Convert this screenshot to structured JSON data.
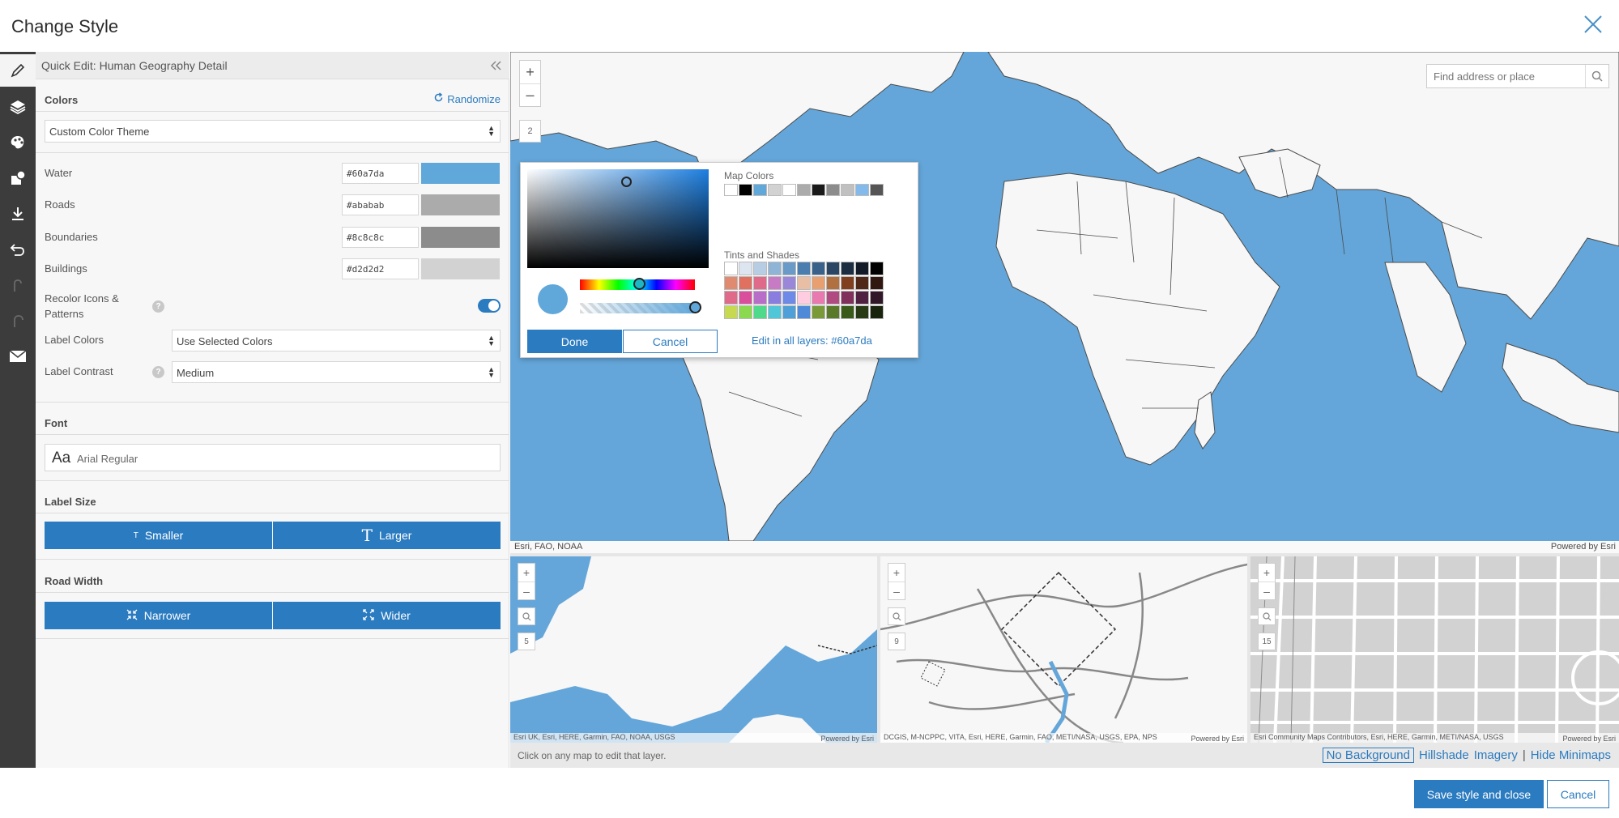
{
  "dialog": {
    "title": "Change Style"
  },
  "panel": {
    "header": "Quick Edit: Human Geography Detail",
    "colors": {
      "title": "Colors",
      "randomize": "Randomize",
      "theme": "Custom Color Theme",
      "rows": [
        {
          "label": "Water",
          "hex": "#60a7da",
          "color": "#60a7da"
        },
        {
          "label": "Roads",
          "hex": "#ababab",
          "color": "#ababab"
        },
        {
          "label": "Boundaries",
          "hex": "#8c8c8c",
          "color": "#8c8c8c"
        },
        {
          "label": "Buildings",
          "hex": "#d2d2d2",
          "color": "#d2d2d2"
        }
      ],
      "recolor_label": "Recolor Icons & Patterns",
      "recolor_on": true,
      "label_colors_label": "Label Colors",
      "label_colors_value": "Use Selected Colors",
      "label_contrast_label": "Label Contrast",
      "label_contrast_value": "Medium"
    },
    "font": {
      "title": "Font",
      "sample": "Aa",
      "name": "Arial Regular"
    },
    "label_size": {
      "title": "Label Size",
      "smaller": "Smaller",
      "larger": "Larger"
    },
    "road_width": {
      "title": "Road Width",
      "narrower": "Narrower",
      "wider": "Wider"
    }
  },
  "map": {
    "zoom_level": "2",
    "search_placeholder": "Find address or place",
    "attribution": "Esri, FAO, NOAA",
    "powered": "Powered by Esri",
    "minimaps": [
      {
        "level": "5",
        "attribution": "Esri UK, Esri, HERE, Garmin, FAO, NOAA, USGS",
        "powered": "Powered by Esri"
      },
      {
        "level": "9",
        "attribution": "DCGIS, M-NCPPC, VITA, Esri, HERE, Garmin, FAO, METI/NASA, USGS, EPA, NPS",
        "powered": "Powered by Esri"
      },
      {
        "level": "15",
        "attribution": "Esri Community Maps Contributors, Esri, HERE, Garmin, METI/NASA, USGS",
        "powered": "Powered by Esri"
      }
    ],
    "hint": "Click on any map to edit that layer.",
    "basemap_links": [
      "No Background",
      "Hillshade",
      "Imagery",
      "Hide Minimaps"
    ]
  },
  "color_picker": {
    "map_colors_title": "Map Colors",
    "map_colors": [
      "#ffffff",
      "#000000",
      "#60a7da",
      "#d2d2d2",
      "#ffffff",
      "#ababab",
      "#1a1a1a",
      "#8c8c8c",
      "#c0c0c0",
      "#84b9ec",
      "#555555"
    ],
    "tints_title": "Tints and Shades",
    "tints": [
      [
        "#ffffff",
        "#dde6f0",
        "#b6cde3",
        "#8fb4d6",
        "#6a9bc8",
        "#4b7eae",
        "#3a6189",
        "#2a4664",
        "#1c2d41",
        "#111a26",
        "#000000"
      ],
      [
        "#e08a6f",
        "#e07060",
        "#e06a8a",
        "#c77bc4",
        "#9a87d9",
        "#e8bfa4",
        "#e8a070",
        "#b07040",
        "#804020",
        "#502818",
        "#301810"
      ],
      [
        "#e06a8a",
        "#d94f9c",
        "#b86ec9",
        "#8a7de0",
        "#6e8ae8",
        "#ffcce0",
        "#e87ab0",
        "#b04a80",
        "#80305a",
        "#502040",
        "#301828"
      ],
      [
        "#c7d94f",
        "#8ad94f",
        "#4fd98a",
        "#4fc7d9",
        "#4fa0d9",
        "#4f8ad9",
        "#7a9a3a",
        "#5a7a2a",
        "#3a5a1a",
        "#283a14",
        "#18240c"
      ]
    ],
    "selected_color": "#60a7da",
    "done": "Done",
    "cancel": "Cancel",
    "edit_all": "Edit in all layers: #60a7da"
  },
  "actions": {
    "save": "Save style and close",
    "cancel": "Cancel"
  },
  "icons": [
    "close-icon",
    "pencil-icon",
    "layers-icon",
    "palette-icon",
    "style-icon",
    "download-icon",
    "undo-icon",
    "undo-disabled-icon",
    "redo-disabled-icon",
    "mail-icon",
    "search-icon",
    "collapse-icon",
    "refresh-icon"
  ]
}
